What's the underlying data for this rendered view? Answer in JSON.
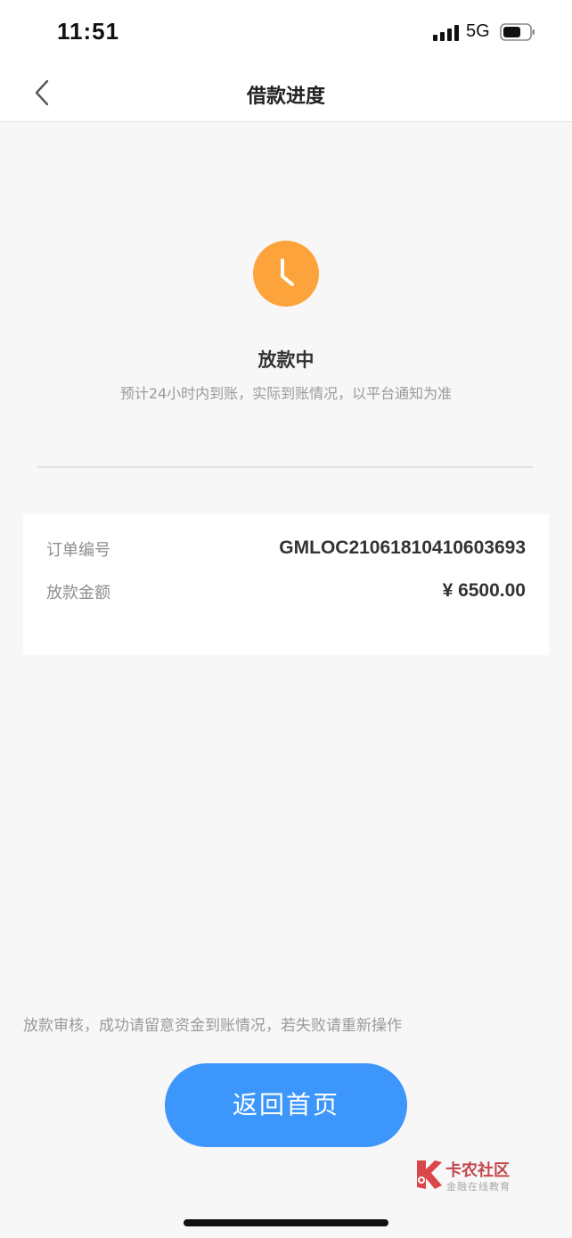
{
  "status_bar": {
    "time": "11:51",
    "network": "5G",
    "icons": [
      "signal-icon",
      "battery-icon"
    ]
  },
  "nav": {
    "title": "借款进度",
    "back_icon": "chevron-left-icon"
  },
  "status": {
    "icon": "clock-icon",
    "icon_color": "#fda33c",
    "title": "放款中",
    "description": "预计24小时内到账，实际到账情况，以平台通知为准"
  },
  "order_info": {
    "rows": [
      {
        "label": "订单编号",
        "value": "GMLOC21061810410603693"
      },
      {
        "label": "放款金额",
        "value": "¥ 6500.00"
      }
    ]
  },
  "footer": {
    "note": "放款审核，成功请留意资金到账情况，若失败请重新操作",
    "home_button_label": "返回首页",
    "button_color": "#3d96fb"
  },
  "watermark": {
    "title": "卡农社区",
    "subtitle": "金融在线教育"
  }
}
